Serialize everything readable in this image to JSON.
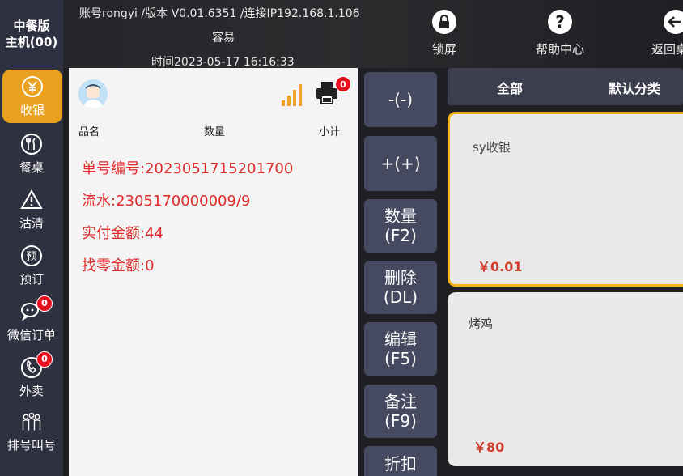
{
  "brand": {
    "line1": "中餐版",
    "line2": "主机(00)"
  },
  "header": {
    "account_line": "账号rongyi /版本 V0.01.6351 /连接IP192.168.1.106",
    "shop_name": "容易",
    "time_line": "时间2023-05-17 16:16:33",
    "buttons": [
      {
        "label": "锁屏",
        "icon": "lock-icon"
      },
      {
        "label": "帮助中心",
        "icon": "help-icon"
      },
      {
        "label": "返回桌",
        "icon": "back-icon"
      }
    ]
  },
  "nav": {
    "items": [
      {
        "label": "收银",
        "icon": "cashier-icon",
        "active": true
      },
      {
        "label": "餐桌",
        "icon": "dining-icon"
      },
      {
        "label": "沽清",
        "icon": "warning-icon"
      },
      {
        "label": "预订",
        "icon": "reserve-icon"
      },
      {
        "label": "微信订单",
        "icon": "wechat-icon",
        "badge": "0"
      },
      {
        "label": "外卖",
        "icon": "phone-icon",
        "badge": "0"
      },
      {
        "label": "排号叫号",
        "icon": "queue-icon"
      }
    ]
  },
  "order": {
    "printer_badge": "0",
    "columns": {
      "name": "品名",
      "qty": "数量",
      "subtotal": "小计"
    },
    "lines": {
      "order_no": "单号编号:2023051715201700",
      "serial": "流水:2305170000009/9",
      "paid": "实付金额:44",
      "change": "找零金额:0"
    }
  },
  "actions": {
    "minus": "-(-)",
    "plus": "+(+)",
    "qty_1": "数量",
    "qty_2": "(F2)",
    "del_1": "删除",
    "del_2": "(DL)",
    "edit_1": "编辑",
    "edit_2": "(F5)",
    "note_1": "备注",
    "note_2": "(F9)",
    "discount": "折扣"
  },
  "categories": {
    "all": "全部",
    "default": "默认分类"
  },
  "products": [
    {
      "name": "sy收银",
      "price": "￥0.01"
    },
    {
      "name": "烤鸡",
      "price": "￥80"
    }
  ],
  "colors": {
    "accent": "#e8a21f",
    "nav_bg": "#2f3140",
    "price": "#d43a2a",
    "order_text": "#e02a2a"
  }
}
